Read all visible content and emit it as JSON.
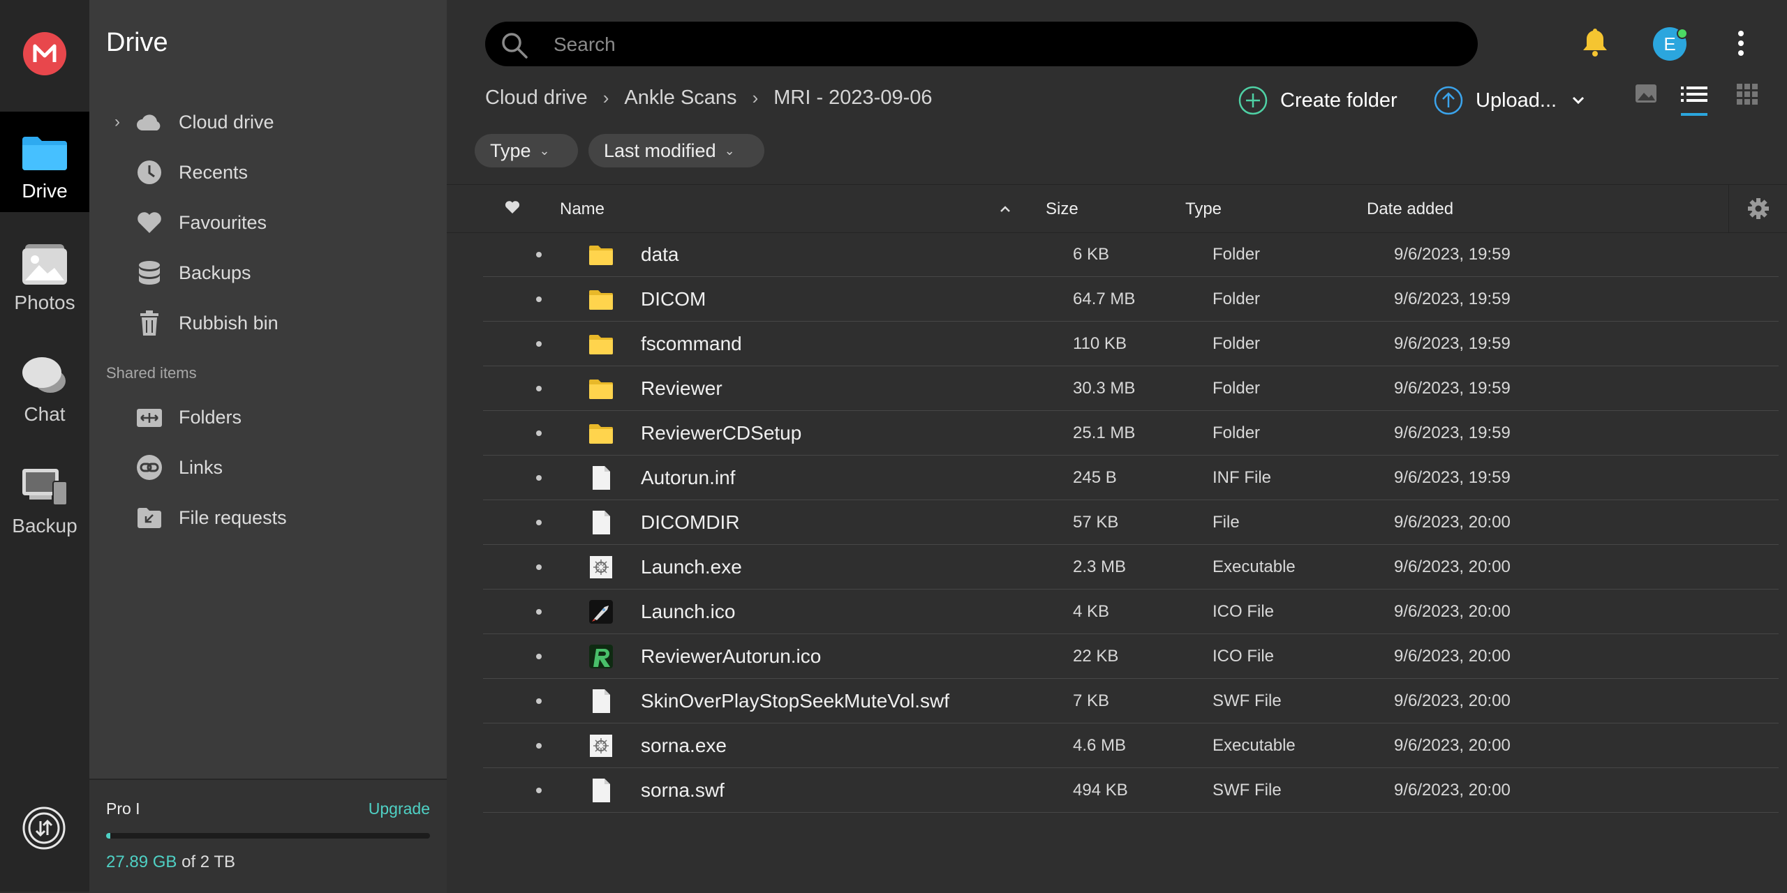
{
  "rail": {
    "items": [
      {
        "label": "Drive"
      },
      {
        "label": "Photos"
      },
      {
        "label": "Chat"
      },
      {
        "label": "Backup"
      }
    ]
  },
  "sidebar": {
    "title": "Drive",
    "items": [
      {
        "label": "Cloud drive",
        "icon": "cloud-icon"
      },
      {
        "label": "Recents",
        "icon": "clock-icon"
      },
      {
        "label": "Favourites",
        "icon": "heart-icon"
      },
      {
        "label": "Backups",
        "icon": "database-icon"
      },
      {
        "label": "Rubbish bin",
        "icon": "trash-icon"
      }
    ],
    "shared_label": "Shared items",
    "shared_items": [
      {
        "label": "Folders",
        "icon": "shared-folder-icon"
      },
      {
        "label": "Links",
        "icon": "link-icon"
      },
      {
        "label": "File requests",
        "icon": "file-request-icon"
      }
    ],
    "storage": {
      "plan": "Pro I",
      "upgrade": "Upgrade",
      "used": "27.89 GB",
      "of_total": " of 2 TB",
      "used_fraction": 0.014
    }
  },
  "search": {
    "placeholder": "Search"
  },
  "avatar": {
    "initial": "E"
  },
  "breadcrumb": [
    "Cloud drive",
    "Ankle Scans",
    "MRI - 2023-09-06"
  ],
  "actions": {
    "create_folder": "Create folder",
    "upload": "Upload..."
  },
  "filters": {
    "type": "Type",
    "last_modified": "Last modified"
  },
  "table": {
    "headers": {
      "name": "Name",
      "size": "Size",
      "type": "Type",
      "date": "Date added"
    },
    "rows": [
      {
        "name": "data",
        "size": "6 KB",
        "type": "Folder",
        "date": "9/6/2023, 19:59",
        "kind": "folder"
      },
      {
        "name": "DICOM",
        "size": "64.7 MB",
        "type": "Folder",
        "date": "9/6/2023, 19:59",
        "kind": "folder"
      },
      {
        "name": "fscommand",
        "size": "110 KB",
        "type": "Folder",
        "date": "9/6/2023, 19:59",
        "kind": "folder"
      },
      {
        "name": "Reviewer",
        "size": "30.3 MB",
        "type": "Folder",
        "date": "9/6/2023, 19:59",
        "kind": "folder"
      },
      {
        "name": "ReviewerCDSetup",
        "size": "25.1 MB",
        "type": "Folder",
        "date": "9/6/2023, 19:59",
        "kind": "folder"
      },
      {
        "name": "Autorun.inf",
        "size": "245 B",
        "type": "INF File",
        "date": "9/6/2023, 19:59",
        "kind": "file"
      },
      {
        "name": "DICOMDIR",
        "size": "57 KB",
        "type": "File",
        "date": "9/6/2023, 20:00",
        "kind": "file"
      },
      {
        "name": "Launch.exe",
        "size": "2.3 MB",
        "type": "Executable",
        "date": "9/6/2023, 20:00",
        "kind": "exe"
      },
      {
        "name": "Launch.ico",
        "size": "4 KB",
        "type": "ICO File",
        "date": "9/6/2023, 20:00",
        "kind": "ico-rocket"
      },
      {
        "name": "ReviewerAutorun.ico",
        "size": "22 KB",
        "type": "ICO File",
        "date": "9/6/2023, 20:00",
        "kind": "ico-green"
      },
      {
        "name": "SkinOverPlayStopSeekMuteVol.swf",
        "size": "7 KB",
        "type": "SWF File",
        "date": "9/6/2023, 20:00",
        "kind": "file"
      },
      {
        "name": "sorna.exe",
        "size": "4.6 MB",
        "type": "Executable",
        "date": "9/6/2023, 20:00",
        "kind": "exe"
      },
      {
        "name": "sorna.swf",
        "size": "494 KB",
        "type": "SWF File",
        "date": "9/6/2023, 20:00",
        "kind": "file"
      }
    ]
  }
}
